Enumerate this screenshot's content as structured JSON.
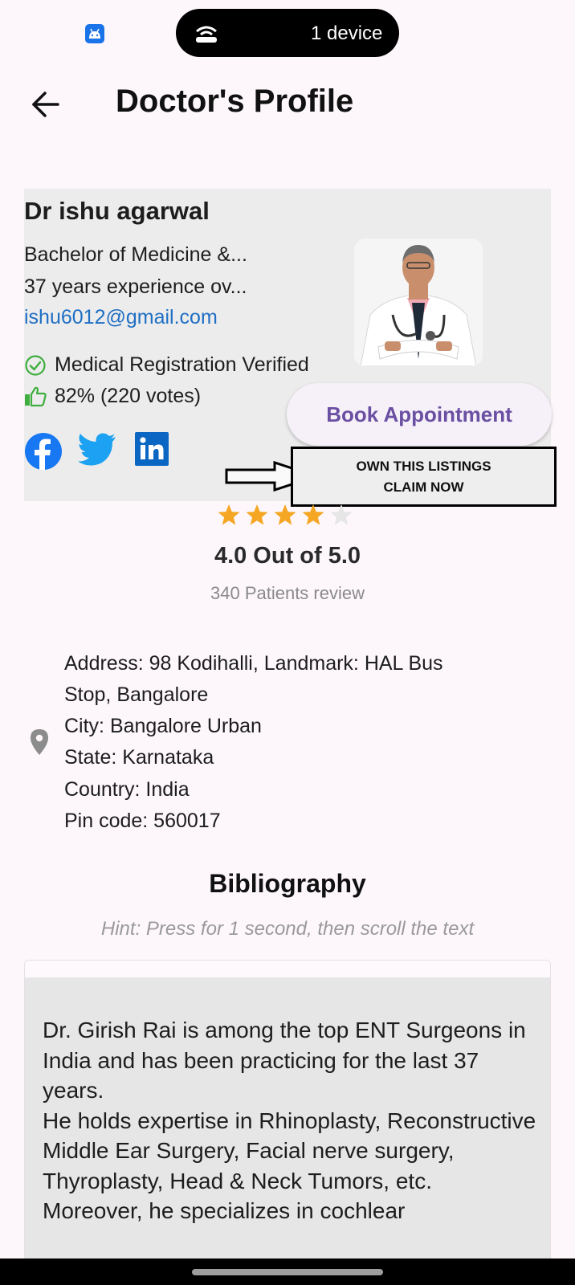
{
  "status_bar": {
    "device_text": "1 device",
    "icons": [
      "android-app-icon",
      "cast-icon"
    ]
  },
  "header": {
    "title": "Doctor's Profile",
    "back_icon": "arrow-left-icon"
  },
  "doctor": {
    "name": "Dr ishu agarwal",
    "degree": "Bachelor of Medicine &...",
    "experience": "37 years experience ov...",
    "email": "ishu6012@gmail.com",
    "verified": "Medical Registration Verified",
    "votes": "82% (220 votes)",
    "social": [
      "facebook-icon",
      "twitter-icon",
      "linkedin-icon"
    ]
  },
  "book_button": "Book Appointment",
  "claim": {
    "line1": "OWN THIS LISTINGS",
    "line2": "CLAIM NOW"
  },
  "rating": {
    "value": 4,
    "max": 5,
    "text": "4.0 Out of 5.0",
    "reviews": "340 Patients review",
    "colors": {
      "filled": "#f5a623",
      "empty": "#e6e6e6"
    }
  },
  "address": {
    "line1": "Address: 98 Kodihalli, Landmark: HAL Bus",
    "line2": "Stop, Bangalore",
    "city": "City: Bangalore Urban",
    "state": "State: Karnataka",
    "country": "Country: India",
    "pin": "Pin code: 560017"
  },
  "bibliography": {
    "title": "Bibliography",
    "hint": "Hint: Press for 1 second, then scroll the text",
    "text": "Dr. Girish Rai is among the top ENT Surgeons in India and has been practicing for the last 37 years.\nHe holds expertise in Rhinoplasty, Reconstructive Middle Ear Surgery, Facial nerve surgery, Thyroplasty, Head & Neck Tumors, etc.\nMoreover, he specializes in cochlear"
  },
  "colors": {
    "accent": "#6a4fa2",
    "link": "#1f6fc4",
    "verified_green": "#3fae3f",
    "facebook": "#1877f2",
    "twitter": "#1da1f2",
    "linkedin": "#0a66c2"
  }
}
